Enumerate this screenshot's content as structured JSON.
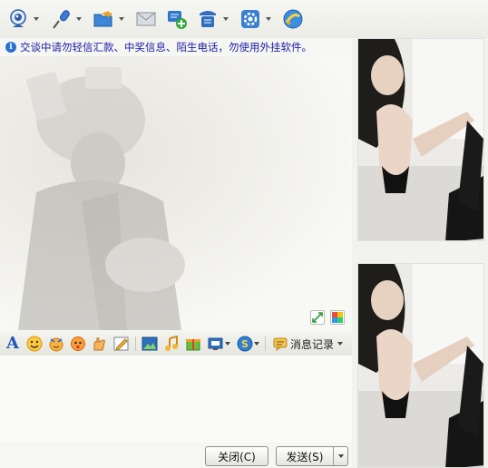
{
  "toolbar": {
    "items": [
      {
        "icon": "webcam-icon",
        "has_dropdown": true
      },
      {
        "icon": "microphone-icon",
        "has_dropdown": true
      },
      {
        "icon": "folder-transfer-icon",
        "has_dropdown": true
      },
      {
        "icon": "mail-icon",
        "has_dropdown": false
      },
      {
        "icon": "create-group-icon",
        "has_dropdown": false
      },
      {
        "icon": "contact-card-icon",
        "has_dropdown": true
      },
      {
        "icon": "apps-gear-icon",
        "has_dropdown": true
      },
      {
        "icon": "browser-icon",
        "has_dropdown": false
      }
    ]
  },
  "warning": {
    "text": "交谈中请勿轻信汇款、中奖信息、陌生电话，勿使用外挂软件。",
    "color": "#1d1da8"
  },
  "input_toolbar": {
    "message_record_label": "消息记录"
  },
  "buttons": {
    "close_label": "关闭(C)",
    "send_label": "发送(S)"
  },
  "colors": {
    "accent": "#2b6fd6",
    "background": "#f6f6f2"
  }
}
